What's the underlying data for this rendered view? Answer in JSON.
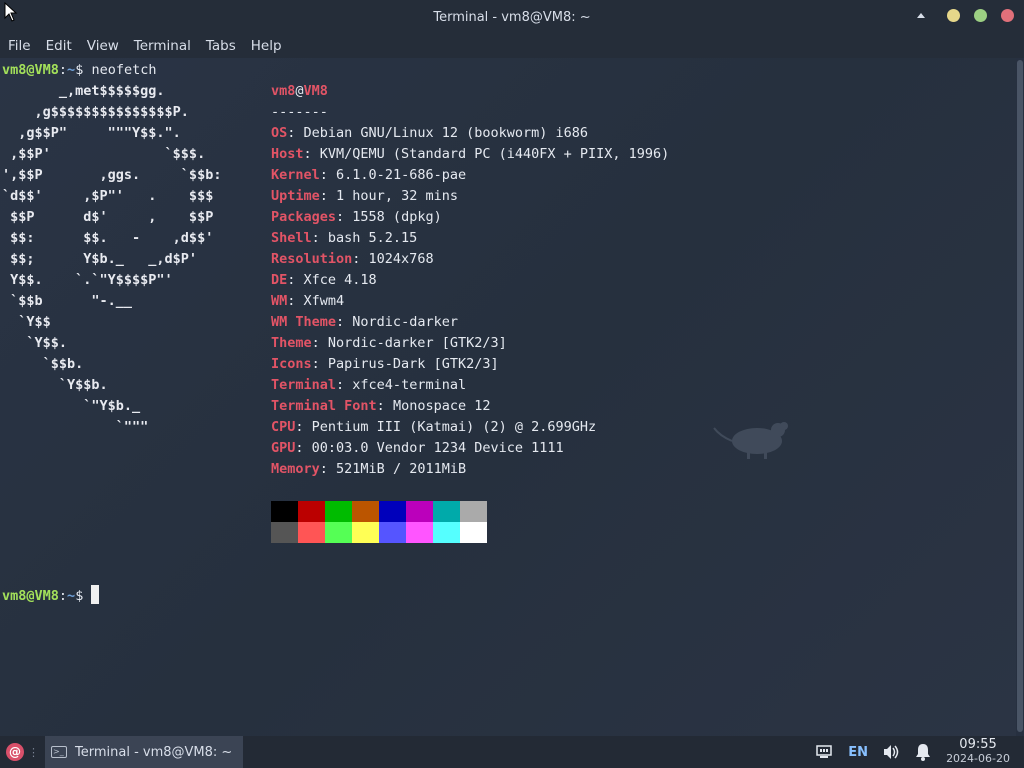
{
  "window": {
    "title": "Terminal - vm8@VM8: ~"
  },
  "menu": [
    "File",
    "Edit",
    "View",
    "Terminal",
    "Tabs",
    "Help"
  ],
  "prompt": {
    "user": "vm8@VM8",
    "sep": ":",
    "path": "~",
    "symbol": "$",
    "command": "neofetch"
  },
  "logo_lines": [
    "       _,met$$$$$gg.",
    "    ,g$$$$$$$$$$$$$$$P.",
    "  ,g$$P\"     \"\"\"Y$$.\".",
    " ,$$P'              `$$$.",
    "',$$P       ,ggs.     `$$b:",
    "`d$$'     ,$P\"'   .    $$$",
    " $$P      d$'     ,    $$P",
    " $$:      $$.   -    ,d$$'",
    " $$;      Y$b._   _,d$P'",
    " Y$$.    `.`\"Y$$$$P\"'",
    " `$$b      \"-.__",
    "  `Y$$",
    "   `Y$$.",
    "     `$$b.",
    "       `Y$$b.",
    "          `\"Y$b._",
    "              `\"\"\""
  ],
  "info": {
    "header_user": "vm8",
    "header_at": "@",
    "header_host": "VM8",
    "dashes": "-------",
    "rows": [
      {
        "key": "OS",
        "value": "Debian GNU/Linux 12 (bookworm) i686"
      },
      {
        "key": "Host",
        "value": "KVM/QEMU (Standard PC (i440FX + PIIX, 1996)"
      },
      {
        "key": "Kernel",
        "value": "6.1.0-21-686-pae"
      },
      {
        "key": "Uptime",
        "value": "1 hour, 32 mins"
      },
      {
        "key": "Packages",
        "value": "1558 (dpkg)"
      },
      {
        "key": "Shell",
        "value": "bash 5.2.15"
      },
      {
        "key": "Resolution",
        "value": "1024x768"
      },
      {
        "key": "DE",
        "value": "Xfce 4.18"
      },
      {
        "key": "WM",
        "value": "Xfwm4"
      },
      {
        "key": "WM Theme",
        "value": "Nordic-darker"
      },
      {
        "key": "Theme",
        "value": "Nordic-darker [GTK2/3]"
      },
      {
        "key": "Icons",
        "value": "Papirus-Dark [GTK2/3]"
      },
      {
        "key": "Terminal",
        "value": "xfce4-terminal"
      },
      {
        "key": "Terminal Font",
        "value": "Monospace 12"
      },
      {
        "key": "CPU",
        "value": "Pentium III (Katmai) (2) @ 2.699GHz"
      },
      {
        "key": "GPU",
        "value": "00:03.0 Vendor 1234 Device 1111"
      },
      {
        "key": "Memory",
        "value": "521MiB / 2011MiB"
      }
    ],
    "palette": [
      "#000000",
      "#bb0000",
      "#00bb00",
      "#bb5500",
      "#0000bb",
      "#bb00bb",
      "#00aaaa",
      "#aaaaaa",
      "#555555",
      "#ff5555",
      "#55ff55",
      "#ffff55",
      "#5555ff",
      "#ff55ff",
      "#55ffff",
      "#ffffff"
    ]
  },
  "taskbar": {
    "task_label": "Terminal - vm8@VM8: ~",
    "lang": "EN",
    "time": "09:55",
    "date": "2024-06-20"
  },
  "colors": {
    "window_controls": [
      "#e6d78a",
      "#9ccf83",
      "#e0707a"
    ]
  }
}
